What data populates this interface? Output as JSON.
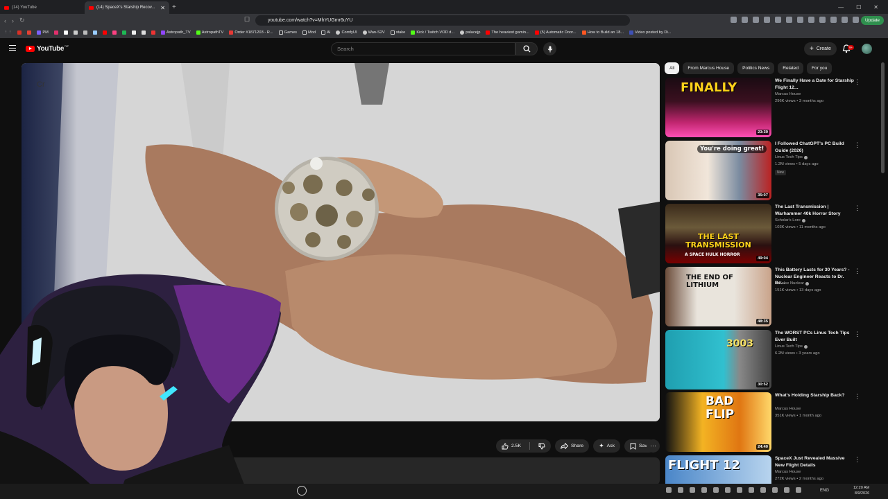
{
  "browser": {
    "tabs": [
      {
        "label": "(14) YouTube",
        "active": false
      },
      {
        "label": "(14) SpaceX's Starship Recov...",
        "active": true
      }
    ],
    "url": "youtube.com/watch?v=MhYUGmr6uYU",
    "update_label": "Update",
    "bookmarks": [
      "PM",
      "Astropath_TV",
      "AstropathTV",
      "Order #1871203 - R...",
      "Games",
      "Mod",
      "AI",
      "ComfyUI",
      "Wan-S2V",
      "stake",
      "Kick / Twitch VOD d...",
      "palacejp",
      "The heaviest gamin...",
      "(5) Automatic Door...",
      "How to Build an 18...",
      "Video posted by Di..."
    ]
  },
  "youtube": {
    "logo_text": "YouTube",
    "region": "NZ",
    "search_placeholder": "Search",
    "create_label": "Create",
    "notifications": "9+",
    "player": {
      "watermark": "Cr"
    },
    "actions": {
      "likes": "2.5K",
      "share": "Share",
      "ask": "Ask",
      "save": "Save"
    },
    "chips": [
      "All",
      "From Marcus House",
      "Politics News",
      "Related",
      "For you"
    ],
    "recommendations": [
      {
        "title": "We Finally Have a Date for Starship Flight 12...",
        "channel": "Marcus House",
        "views": "296K views",
        "age": "3 months ago",
        "duration": "23:39",
        "thumb_text": "FINALLY",
        "verified": false,
        "badge": ""
      },
      {
        "title": "I Followed ChatGPT's PC Build Guide (2026)",
        "channel": "Linus Tech Tips",
        "views": "1.2M views",
        "age": "5 days ago",
        "duration": "35:07",
        "thumb_text": "You're doing great!",
        "verified": true,
        "badge": "New"
      },
      {
        "title": "The Last Transmission | Warhammer 40k Horror Story",
        "channel": "Scholar's Lore",
        "views": "103K views",
        "age": "11 months ago",
        "duration": "49:04",
        "thumb_text": "THE LAST TRANSMISSION",
        "thumb_sub": "A SPACE HULK HORROR",
        "verified": true,
        "badge": ""
      },
      {
        "title": "This Battery Lasts for 30 Years? - Nuclear Engineer Reacts to Dr. Be...",
        "channel": "T. Folse Nuclear",
        "views": "151K views",
        "age": "13 days ago",
        "duration": "48:35",
        "thumb_text": "THE END OF LITHIUM",
        "verified": true,
        "badge": ""
      },
      {
        "title": "The WORST PCs Linus Tech Tips Ever Built",
        "channel": "Linus Tech Tips",
        "views": "6.2M views",
        "age": "3 years ago",
        "duration": "30:52",
        "thumb_text": "3003",
        "verified": true,
        "badge": ""
      },
      {
        "title": "What's Holding Starship Back?",
        "channel": "Marcus House",
        "views": "351K views",
        "age": "1 month ago",
        "duration": "24:40",
        "thumb_text": "BAD FLIP",
        "verified": false,
        "badge": ""
      },
      {
        "title": "SpaceX Just Revealed Massive New Flight Details",
        "channel": "Marcus House",
        "views": "272K views",
        "age": "2 months ago",
        "duration": "",
        "thumb_text": "FLIGHT 12",
        "verified": false,
        "badge": ""
      }
    ]
  },
  "taskbar": {
    "language": "ENG",
    "time": "12:20 AM",
    "date": "8/9/2026"
  },
  "colors": {
    "youtube_red": "#ff0000",
    "background": "#0f0f0f",
    "chip_bg": "#272727"
  }
}
